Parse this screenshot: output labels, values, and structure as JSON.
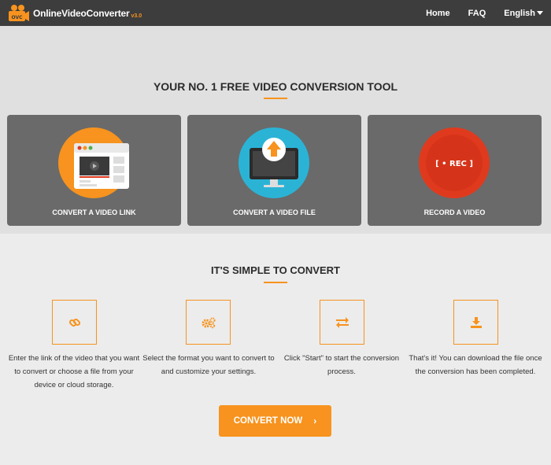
{
  "header": {
    "logo_word1": "Online",
    "logo_word2": "Video",
    "logo_word3": "Converter",
    "logo_version": "v3.0",
    "logo_badge": "OVC",
    "nav": {
      "home": "Home",
      "faq": "FAQ",
      "language": "English"
    }
  },
  "hero": {
    "title": "YOUR NO. 1 FREE VIDEO CONVERSION TOOL",
    "cards": [
      {
        "label": "CONVERT A VIDEO LINK",
        "color": "#f7931e"
      },
      {
        "label": "CONVERT A VIDEO FILE",
        "color": "#2bb3d6"
      },
      {
        "label": "RECORD A VIDEO",
        "color": "#e03a1e",
        "rec_text": "[ • REC ]"
      }
    ]
  },
  "steps": {
    "title": "IT'S SIMPLE TO CONVERT",
    "items": [
      {
        "icon": "link-icon",
        "text": "Enter the link of the video that you want to convert or choose a file from your device or cloud storage."
      },
      {
        "icon": "gears-icon",
        "text": "Select the format you want to convert to and customize your settings."
      },
      {
        "icon": "exchange-icon",
        "text": "Click \"Start\" to start the conversion process."
      },
      {
        "icon": "download-icon",
        "text": "That's it! You can download the file once the conversion has been completed."
      }
    ]
  },
  "cta": {
    "label": "CONVERT NOW",
    "chevron": "›"
  },
  "colors": {
    "accent": "#f7931e",
    "header_bg": "#3d3d3d",
    "card_bg": "#6a6a6a"
  }
}
